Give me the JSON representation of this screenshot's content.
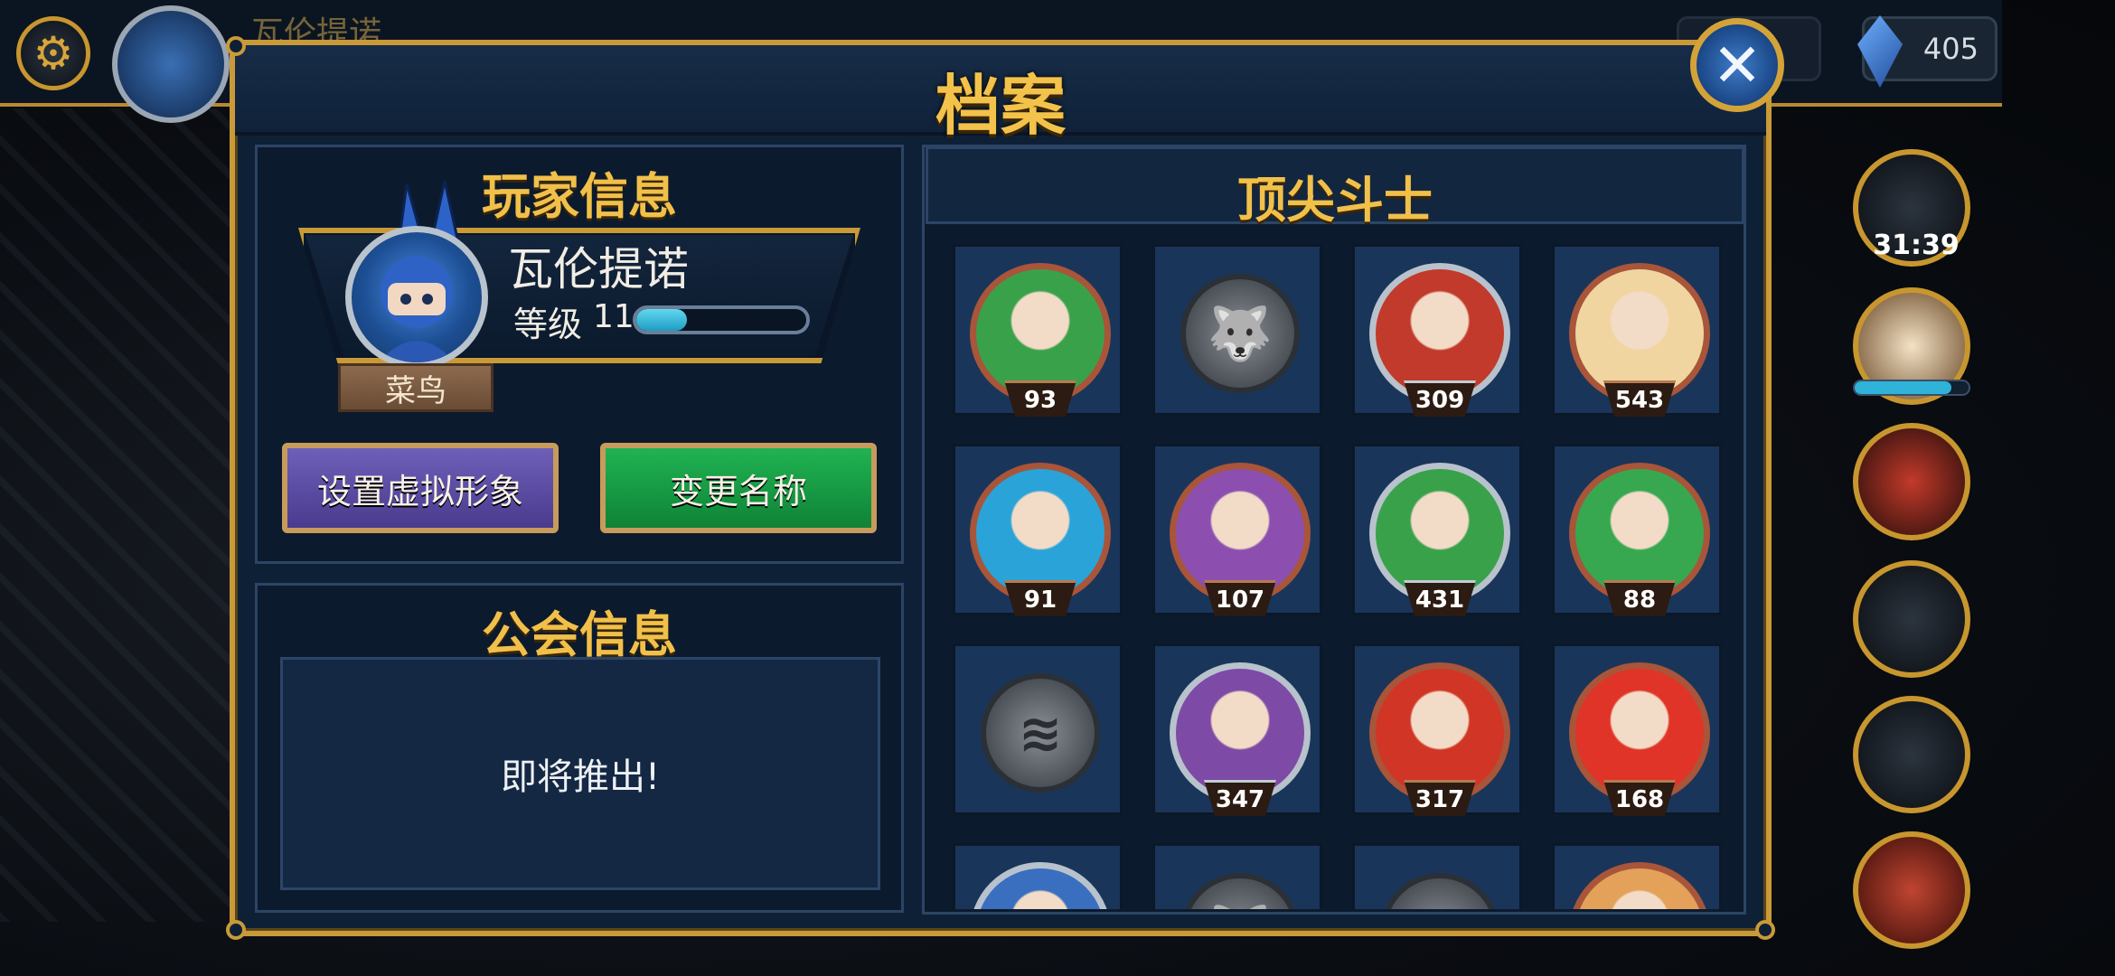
{
  "hud": {
    "player_name": "瓦伦提诺",
    "gems": "405",
    "timer": "31:39",
    "energy_fill": 0.85
  },
  "modal": {
    "title": "档案",
    "close_icon": "close-x-icon"
  },
  "player_info": {
    "title": "玩家信息",
    "name": "瓦伦提诺",
    "level_label": "等级",
    "level": "11",
    "xp_fill": 0.3,
    "rank": "菜鸟",
    "set_avatar_label": "设置虚拟形象",
    "rename_label": "变更名称"
  },
  "guild_info": {
    "title": "公会信息",
    "message": "即将推出!"
  },
  "top_fighters": {
    "title": "顶尖斗士",
    "fighters": [
      {
        "name": "fighter-1",
        "count": "93",
        "bg": "#3aa14b",
        "ring": "bronze",
        "locked": false
      },
      {
        "name": "fighter-2",
        "count": "",
        "bg": "#6b7077",
        "ring": "none",
        "locked": true,
        "icon": "wolf-icon"
      },
      {
        "name": "fighter-3",
        "count": "309",
        "bg": "#c23a2b",
        "ring": "silver",
        "locked": false
      },
      {
        "name": "fighter-4",
        "count": "543",
        "bg": "#f0d5a0",
        "ring": "bronze",
        "locked": false
      },
      {
        "name": "fighter-5",
        "count": "91",
        "bg": "#2aa3d9",
        "ring": "bronze",
        "locked": false
      },
      {
        "name": "fighter-6",
        "count": "107",
        "bg": "#8c4fb0",
        "ring": "bronze",
        "locked": false
      },
      {
        "name": "fighter-7",
        "count": "431",
        "bg": "#3aa14b",
        "ring": "silver",
        "locked": false
      },
      {
        "name": "fighter-8",
        "count": "88",
        "bg": "#37a84f",
        "ring": "bronze",
        "locked": false
      },
      {
        "name": "fighter-9",
        "count": "",
        "bg": "#6b7077",
        "ring": "none",
        "locked": true,
        "icon": "fish-bone-icon"
      },
      {
        "name": "fighter-10",
        "count": "347",
        "bg": "#7d4aa6",
        "ring": "silver",
        "locked": false
      },
      {
        "name": "fighter-11",
        "count": "317",
        "bg": "#d13526",
        "ring": "bronze",
        "locked": false
      },
      {
        "name": "fighter-12",
        "count": "168",
        "bg": "#e03428",
        "ring": "bronze",
        "locked": false
      },
      {
        "name": "fighter-13",
        "count": "",
        "bg": "#3a6fbf",
        "ring": "silver",
        "locked": false
      },
      {
        "name": "fighter-14",
        "count": "",
        "bg": "#6b7077",
        "ring": "none",
        "locked": true,
        "icon": "wolf-icon"
      },
      {
        "name": "fighter-15",
        "count": "",
        "bg": "#6b7077",
        "ring": "none",
        "locked": true,
        "icon": "gear-lock-icon"
      },
      {
        "name": "fighter-16",
        "count": "",
        "bg": "#e3a15a",
        "ring": "bronze",
        "locked": false
      }
    ]
  }
}
